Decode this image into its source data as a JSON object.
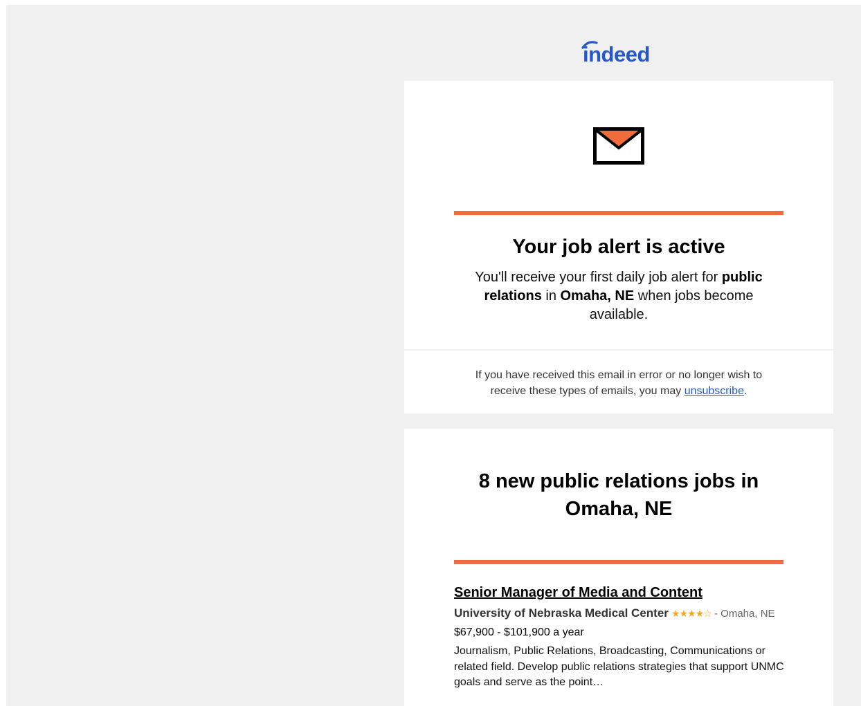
{
  "brand": {
    "logo_text": "indeed",
    "logo_color": "#2557c8",
    "accent_color": "#f26b3a"
  },
  "alert": {
    "icon": "envelope-icon",
    "title": "Your job alert is active",
    "body_prefix": "You'll receive your first daily job alert for ",
    "query": "public relations",
    "body_middle": " in ",
    "location": "Omaha, NE",
    "body_suffix": " when jobs become available."
  },
  "unsubscribe": {
    "text_prefix": "If you have received this email in error or no longer wish to receive these types of emails, you may ",
    "link_label": "unsubscribe",
    "text_suffix": "."
  },
  "jobs": {
    "heading": "8 new public relations jobs in Omaha, NE",
    "items": [
      {
        "title": "Senior Manager of Media and Content",
        "company": "University of Nebraska Medical Center",
        "rating_stars": "★★★★☆",
        "rating": 4,
        "location": "- Omaha, NE",
        "salary": "$67,900 - $101,900 a year",
        "snippet": "Journalism, Public Relations, Broadcasting, Communications or related field. Develop public relations strategies that support UNMC goals and serve as the point…"
      }
    ]
  }
}
